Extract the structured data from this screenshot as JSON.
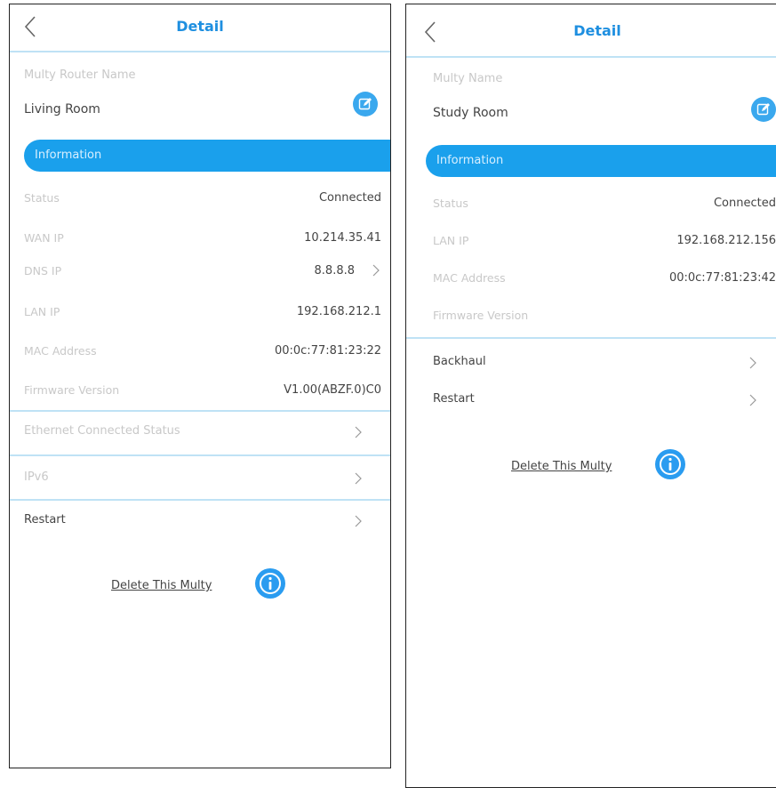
{
  "left": {
    "title": "Detail",
    "name_label": "Multy Router Name",
    "name_value": "Living Room",
    "info_label": "Information",
    "rows": [
      {
        "key": "Status",
        "value": "Connected"
      },
      {
        "key": "WAN IP",
        "value": "10.214.35.41"
      },
      {
        "key": "DNS IP",
        "value": "8.8.8.8"
      },
      {
        "key": "LAN IP",
        "value": "192.168.212.1"
      },
      {
        "key": "MAC Address",
        "value": "00:0c:77:81:23:22"
      },
      {
        "key": "Firmware Version",
        "value": "V1.00(ABZF.0)C0"
      }
    ],
    "nav": [
      "Ethernet Connected Status",
      "IPv6",
      "Restart"
    ],
    "delete_label": "Delete This Multy"
  },
  "right": {
    "title": "Detail",
    "name_label": "Multy Name",
    "name_value": "Study Room",
    "info_label": "Information",
    "rows": [
      {
        "key": "Status",
        "value": "Connected"
      },
      {
        "key": "LAN IP",
        "value": "192.168.212.156"
      },
      {
        "key": "MAC Address",
        "value": "00:0c:77:81:23:42"
      },
      {
        "key": "Firmware Version",
        "value": ""
      }
    ],
    "nav": [
      "Backhaul",
      "Restart"
    ],
    "delete_label": "Delete This Multy"
  },
  "colors": {
    "accent": "#1aa0ec",
    "title": "#1e8fe0",
    "divider": "#bfe2f5",
    "muted_text": "#c8c8c8",
    "body_text": "#444444"
  },
  "icons": {
    "back": "chevron-left-icon",
    "edit": "edit-icon",
    "chevron": "chevron-right-icon",
    "info": "info-icon"
  }
}
